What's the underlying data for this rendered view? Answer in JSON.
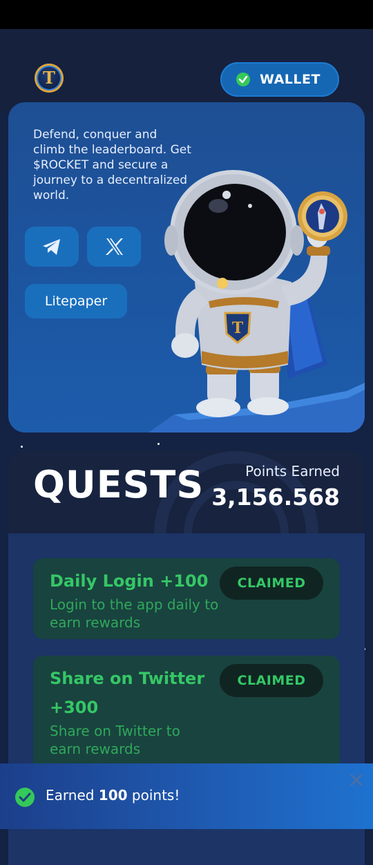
{
  "header": {
    "logo_letter": "T",
    "wallet_label": "WALLET"
  },
  "hero": {
    "description": "Defend, conquer and climb the leaderboard. Get $ROCKET and secure a journey to a decentralized world.",
    "telegram_icon": "telegram-icon",
    "x_icon": "x-icon",
    "litepaper_label": "Litepaper"
  },
  "quests": {
    "title": "QUESTS",
    "points_label": "Points Earned",
    "points_value": "3,156.568",
    "items": [
      {
        "title": "Daily Login +100",
        "description": "Login to the app daily to earn rewards",
        "status": "CLAIMED"
      },
      {
        "title_line1": "Share on Twitter",
        "title_line2": "+300",
        "description": "Share on Twitter to earn rewards",
        "status": "CLAIMED"
      }
    ]
  },
  "toast": {
    "prefix": "Earned ",
    "amount": "100",
    "suffix": " points!"
  },
  "colors": {
    "accent_blue": "#1667b3",
    "success_green": "#35c766",
    "background": "#142244"
  }
}
